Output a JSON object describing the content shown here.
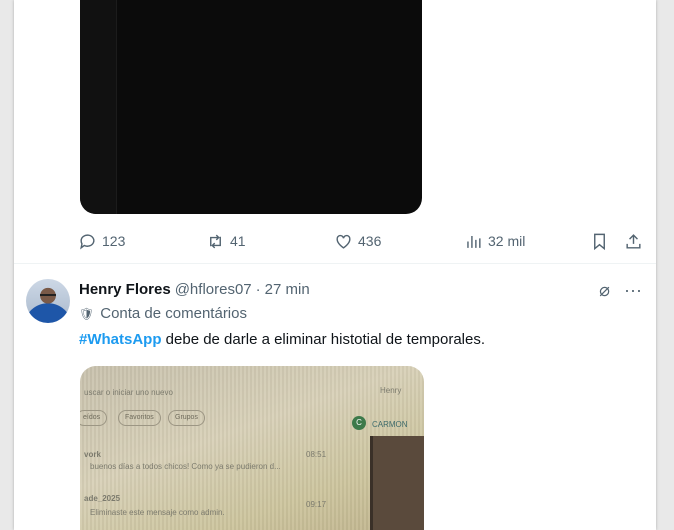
{
  "tweet1": {
    "actions": {
      "replies": "123",
      "retweets": "41",
      "likes": "436",
      "views": "32 mil"
    }
  },
  "tweet2": {
    "name": "Henry Flores",
    "handle": "@hflores07",
    "separator": "·",
    "time": "27 min",
    "community": "Conta de comentários",
    "hashtag": "#WhatsApp",
    "text": " debe de darle a eliminar histotial de temporales.",
    "photo": {
      "search_hint": "uscar o iniciar uno nuevo",
      "chip1": "eídos",
      "chip2": "Favoritos",
      "chip3": "Grupos",
      "chat1_title": "vork",
      "chat1_time": "08:51",
      "chat1_preview": "buenos días a todos chicos! Como ya se pudieron d...",
      "chat2_title": "ade_2025",
      "chat2_time": "09:17",
      "chat2_preview": "Eliminaste este mensaje como admin.",
      "header_right": "Henry",
      "contact_right": "CARMON",
      "avatar_letter": "C"
    }
  },
  "colors": {
    "accent": "#1d9bf0",
    "muted": "#536471",
    "text": "#0f1419"
  }
}
